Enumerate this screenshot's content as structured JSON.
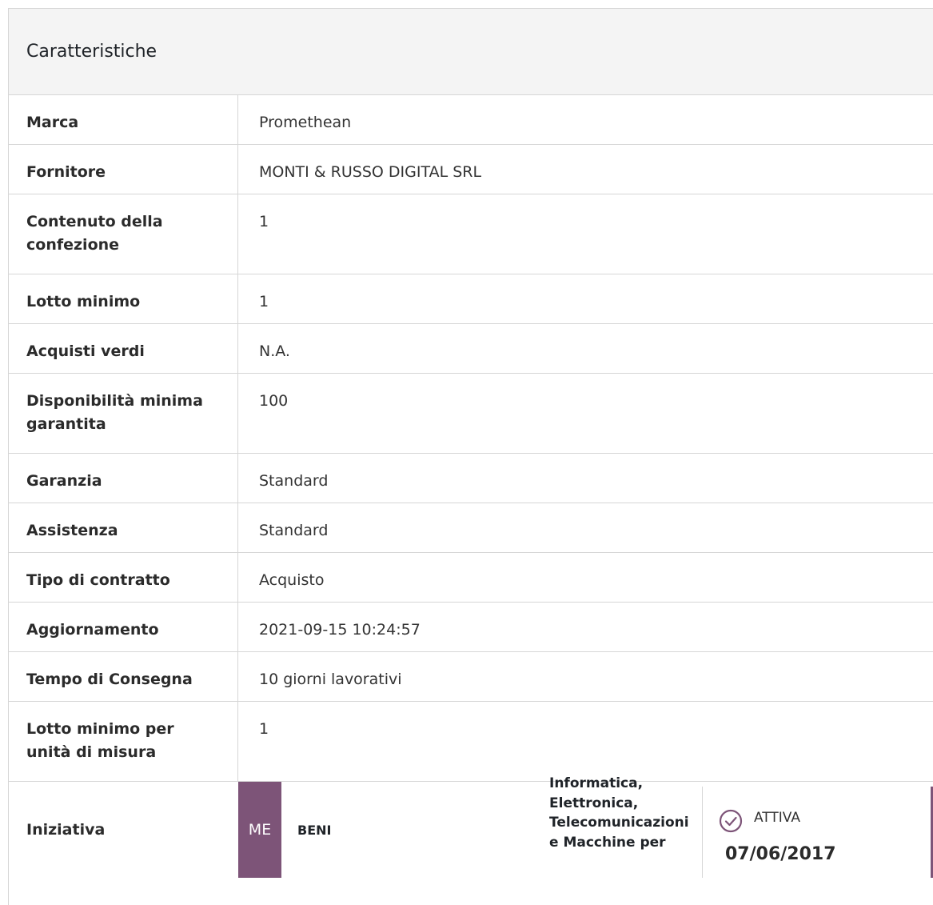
{
  "panel": {
    "title": "Caratteristiche"
  },
  "rows": [
    {
      "label": "Marca",
      "value": "Promethean"
    },
    {
      "label": "Fornitore",
      "value": "MONTI & RUSSO DIGITAL SRL"
    },
    {
      "label": "Contenuto della confezione",
      "value": "1"
    },
    {
      "label": "Lotto minimo",
      "value": "1"
    },
    {
      "label": "Acquisti verdi",
      "value": "N.A."
    },
    {
      "label": "Disponibilità minima garantita",
      "value": "100"
    },
    {
      "label": "Garanzia",
      "value": "Standard"
    },
    {
      "label": "Assistenza",
      "value": "Standard"
    },
    {
      "label": "Tipo di contratto",
      "value": "Acquisto"
    },
    {
      "label": "Aggiornamento",
      "value": "2021-09-15 10:24:57"
    },
    {
      "label": "Tempo di Consegna",
      "value": "10 giorni lavorativi"
    },
    {
      "label": "Lotto minimo per unità di misura",
      "value": "1"
    }
  ],
  "iniziativa": {
    "label": "Iniziativa",
    "code": "ME",
    "type": "BENI",
    "category": "Informatica, Elettronica, Telecomunicazioni e Macchine per",
    "status_label": "ATTIVA",
    "status_date": "07/06/2017",
    "status_icon": "check-circle-icon",
    "accent_color": "#7d5478"
  }
}
